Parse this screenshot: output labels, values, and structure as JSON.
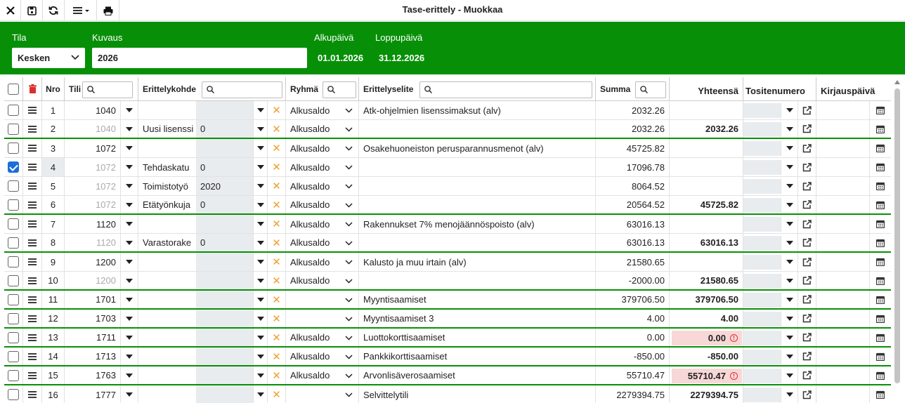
{
  "window": {
    "title": "Tase-erittely - Muokkaa"
  },
  "toolbar": {
    "icons": [
      "close-icon",
      "save-icon",
      "refresh-icon",
      "menu-icon",
      "print-icon"
    ]
  },
  "header": {
    "tila_label": "Tila",
    "tila_value": "Kesken",
    "kuvaus_label": "Kuvaus",
    "kuvaus_value": "2026",
    "alkupaiva_label": "Alkupäivä",
    "alkupaiva_value": "01.01.2026",
    "loppupaiva_label": "Loppupäivä",
    "loppupaiva_value": "31.12.2026"
  },
  "colors": {
    "accent": "#079007",
    "error_bg": "#f8d7d7",
    "x_icon": "#f0a030"
  },
  "columns": {
    "nro": "Nro",
    "tili": "Tili",
    "erittelykohde": "Erittelykohde",
    "ryhma": "Ryhmä",
    "erittelyselite": "Erittelyselite",
    "summa": "Summa",
    "yhteensa": "Yhteensä",
    "tositenumero": "Tositenumero",
    "kirjauspaiva": "Kirjauspäivä"
  },
  "rows": [
    {
      "nro": "1",
      "tili": "1040",
      "tili_muted": false,
      "kohde": "",
      "kohde_val": "",
      "ryhma": "Alkusaldo",
      "selite": "Atk-ohjelmien lisenssimaksut (alv)",
      "summa": "2032.26",
      "yhteensa": "",
      "error": false,
      "checked": false,
      "group_end": false
    },
    {
      "nro": "2",
      "tili": "1040",
      "tili_muted": true,
      "kohde": "Uusi lisenssi",
      "kohde_val": "0",
      "ryhma": "Alkusaldo",
      "selite": "",
      "summa": "2032.26",
      "yhteensa": "2032.26",
      "error": false,
      "checked": false,
      "group_end": true
    },
    {
      "nro": "3",
      "tili": "1072",
      "tili_muted": false,
      "kohde": "",
      "kohde_val": "",
      "ryhma": "Alkusaldo",
      "selite": "Osakehuoneiston perusparannusmenot (alv)",
      "summa": "45725.82",
      "yhteensa": "",
      "error": false,
      "checked": false,
      "group_end": false
    },
    {
      "nro": "4",
      "tili": "1072",
      "tili_muted": true,
      "kohde": "Tehdaskatu",
      "kohde_val": "0",
      "ryhma": "Alkusaldo",
      "selite": "",
      "summa": "17096.78",
      "yhteensa": "",
      "error": false,
      "checked": true,
      "group_end": false
    },
    {
      "nro": "5",
      "tili": "1072",
      "tili_muted": true,
      "kohde": "Toimistotyö",
      "kohde_val": "2020",
      "ryhma": "Alkusaldo",
      "selite": "",
      "summa": "8064.52",
      "yhteensa": "",
      "error": false,
      "checked": false,
      "group_end": false
    },
    {
      "nro": "6",
      "tili": "1072",
      "tili_muted": true,
      "kohde": "Etätyönkuja",
      "kohde_val": "0",
      "ryhma": "Alkusaldo",
      "selite": "",
      "summa": "20564.52",
      "yhteensa": "45725.82",
      "error": false,
      "checked": false,
      "group_end": true
    },
    {
      "nro": "7",
      "tili": "1120",
      "tili_muted": false,
      "kohde": "",
      "kohde_val": "",
      "ryhma": "Alkusaldo",
      "selite": "Rakennukset 7% menojäännöspoisto (alv)",
      "summa": "63016.13",
      "yhteensa": "",
      "error": false,
      "checked": false,
      "group_end": false
    },
    {
      "nro": "8",
      "tili": "1120",
      "tili_muted": true,
      "kohde": "Varastorake",
      "kohde_val": "0",
      "ryhma": "Alkusaldo",
      "selite": "",
      "summa": "63016.13",
      "yhteensa": "63016.13",
      "error": false,
      "checked": false,
      "group_end": true
    },
    {
      "nro": "9",
      "tili": "1200",
      "tili_muted": false,
      "kohde": "",
      "kohde_val": "",
      "ryhma": "Alkusaldo",
      "selite": "Kalusto ja muu irtain (alv)",
      "summa": "21580.65",
      "yhteensa": "",
      "error": false,
      "checked": false,
      "group_end": false
    },
    {
      "nro": "10",
      "tili": "1200",
      "tili_muted": true,
      "kohde": "",
      "kohde_val": "",
      "ryhma": "Alkusaldo",
      "selite": "",
      "summa": "-2000.00",
      "yhteensa": "21580.65",
      "error": false,
      "checked": false,
      "group_end": true
    },
    {
      "nro": "11",
      "tili": "1701",
      "tili_muted": false,
      "kohde": "",
      "kohde_val": "",
      "ryhma": "",
      "selite": "Myyntisaamiset",
      "summa": "379706.50",
      "yhteensa": "379706.50",
      "error": false,
      "checked": false,
      "group_end": true
    },
    {
      "nro": "12",
      "tili": "1703",
      "tili_muted": false,
      "kohde": "",
      "kohde_val": "",
      "ryhma": "",
      "selite": "Myyntisaamiset 3",
      "summa": "4.00",
      "yhteensa": "4.00",
      "error": false,
      "checked": false,
      "group_end": true
    },
    {
      "nro": "13",
      "tili": "1711",
      "tili_muted": false,
      "kohde": "",
      "kohde_val": "",
      "ryhma": "Alkusaldo",
      "selite": "Luottokorttisaamiset",
      "summa": "0.00",
      "yhteensa": "0.00",
      "error": true,
      "checked": false,
      "group_end": true
    },
    {
      "nro": "14",
      "tili": "1713",
      "tili_muted": false,
      "kohde": "",
      "kohde_val": "",
      "ryhma": "Alkusaldo",
      "selite": "Pankkikorttisaamiset",
      "summa": "-850.00",
      "yhteensa": "-850.00",
      "error": false,
      "checked": false,
      "group_end": true
    },
    {
      "nro": "15",
      "tili": "1763",
      "tili_muted": false,
      "kohde": "",
      "kohde_val": "",
      "ryhma": "Alkusaldo",
      "selite": "Arvonlisäverosaamiset",
      "summa": "55710.47",
      "yhteensa": "55710.47",
      "error": true,
      "checked": false,
      "group_end": true
    },
    {
      "nro": "16",
      "tili": "1777",
      "tili_muted": false,
      "kohde": "",
      "kohde_val": "",
      "ryhma": "",
      "selite": "Selvittelytili",
      "summa": "2279394.75",
      "yhteensa": "2279394.75",
      "error": false,
      "checked": false,
      "group_end": false
    }
  ]
}
